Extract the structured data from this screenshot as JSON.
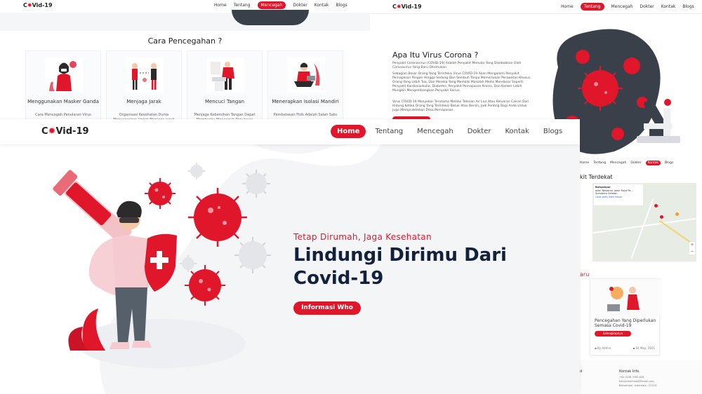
{
  "nav": {
    "logo_text": "Vid-19",
    "items": [
      "Home",
      "Tentang",
      "Mencegah",
      "Dokter",
      "Kontak",
      "Blogs"
    ]
  },
  "hero": {
    "tagline": "Tetap Dirumah, Jaga Kesehatan",
    "headline": "Lindungi Dirimu Dari Covid-19",
    "cta_label": "Informasi Who"
  },
  "prevention": {
    "title": "Cara Pencegahan ?",
    "cards": [
      {
        "title": "Menggunakan Masker Ganda",
        "desc": "Cara Mencegah Penularan Virus"
      },
      {
        "title": "Menjaga Jarak",
        "desc": "Organisasi Kesehatan Dunia Menyarankan Untuk Menjaga Jarak"
      },
      {
        "title": "Mencuci Tangan",
        "desc": "Menjaga Kebersihan Tangan Dapat Membantu Mencegah Penularan"
      },
      {
        "title": "Menerapkan Isolasi Mandiri",
        "desc": "Pembatasan Fisik Adalah Salah Satu"
      }
    ]
  },
  "about": {
    "title": "Apa Itu Virus Corona ?",
    "paragraphs": [
      "Penyakit Coronavirus (COVID-19) Adalah Penyakit Menular Yang Disebabkan Oleh Coronavirus Yang Baru Ditemukan.",
      "Sebagian Besar Orang Yang Terinfeksi Virus COVID-19 Akan Mengalami Penyakit Pernapasan Ringan Hingga Sedang Dan Sembuh Tanpa Memerlukan Perawatan Khusus. Orang Yang Lebih Tua, Dan Mereka Yang Memiliki Masalah Medis Mendasar Seperti Penyakit Kardiovaskular, Diabetes, Penyakit Pernapasan Kronis, Dan Kanker Lebih Mungkin Mengembangkan Penyakit Serius.",
      "Virus COVID-19 Menyebar Terutama Melalui Tetesan Air Liur Atau Keluaran Cairan Dari Hidung Ketika Orang Yang Terinfeksi Batuk Atau Bersin, Jadi Penting Bagi Anda Untuk Juga Mempraktikkan Etika Pernapasan."
    ]
  },
  "map_section": {
    "title": "kit Terdekat",
    "info_title": "Batuampar",
    "info_line": "Jalan Nasional, Jalan Raya Pa... Sumatera Selatan",
    "info_link": "Lihat peta lebih besar",
    "zoom_in": "+",
    "zoom_out": "−"
  },
  "blog": {
    "title": "aru",
    "post_title": "Pencegahan Yang Diperlukan Semasa Covid-19",
    "button": "Selengkapnya",
    "author": "By Admin",
    "date": "01 May, 2021"
  },
  "footer": {
    "left_label": "d",
    "contact_title": "Kontak Info",
    "phone": "+62 0238 3765 828",
    "email": "bebiyinkartikadi@email.com",
    "address": "Batuampar, Indonesia - 27213"
  },
  "colors": {
    "accent": "#e0162b",
    "dark_blob": "#3a4049",
    "headline": "#14213d"
  }
}
